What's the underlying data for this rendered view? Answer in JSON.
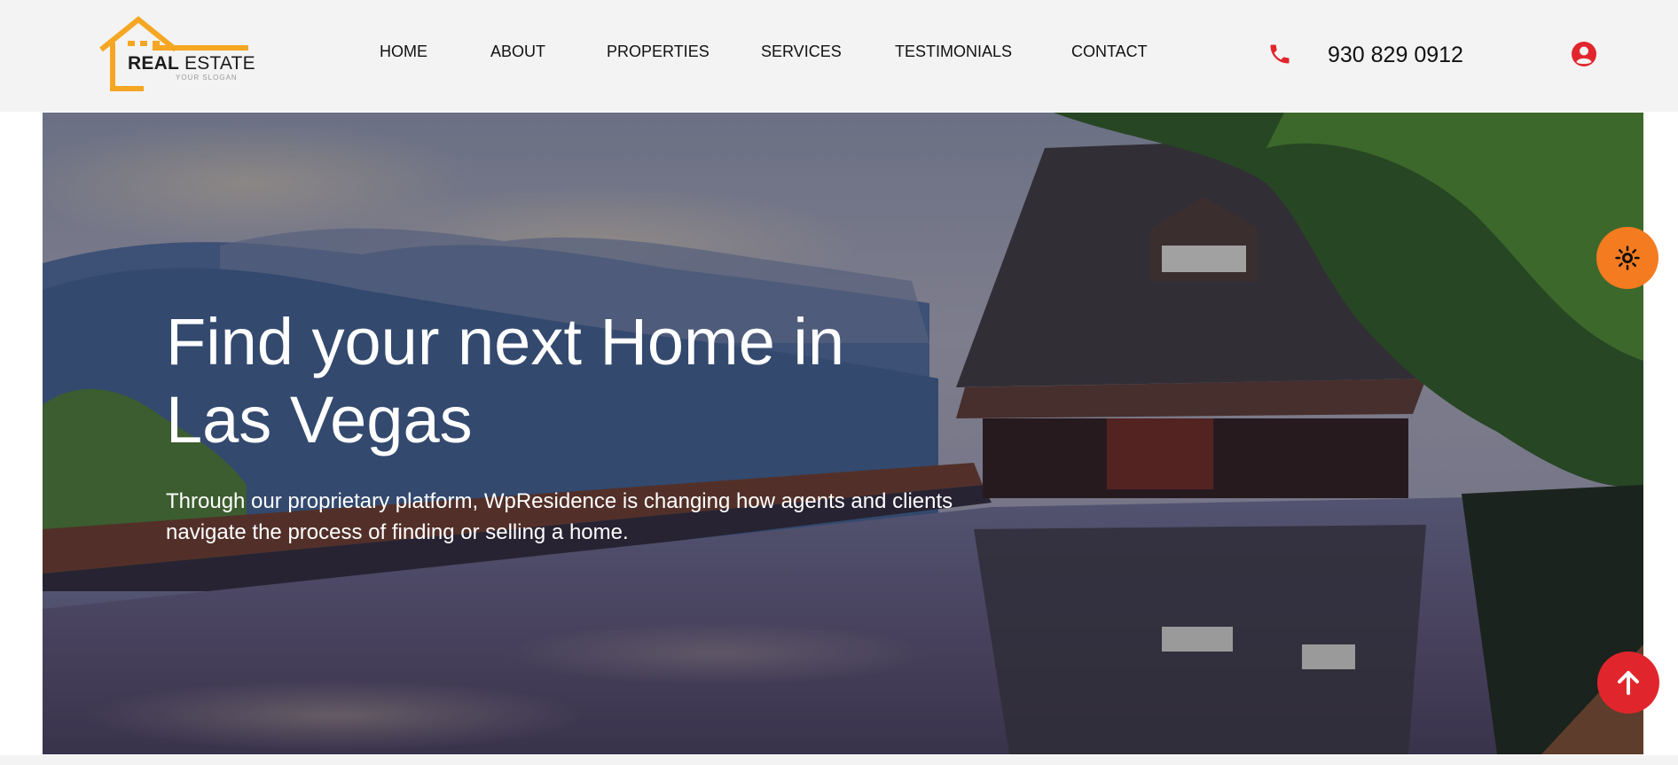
{
  "brand": {
    "name_part1": "REAL",
    "name_part2": "ESTATE",
    "slogan": "YOUR SLOGAN",
    "color": "#f5a623"
  },
  "nav": {
    "items": [
      {
        "label": "HOME"
      },
      {
        "label": "ABOUT"
      },
      {
        "label": "PROPERTIES"
      },
      {
        "label": "SERVICES"
      },
      {
        "label": "TESTIMONIALS"
      },
      {
        "label": "CONTACT"
      }
    ]
  },
  "contact": {
    "phone": "930 829 0912",
    "phone_icon": "phone-icon",
    "accent_color": "#e0262c"
  },
  "account": {
    "icon": "user-icon"
  },
  "hero": {
    "title": "Find your next Home in Las Vegas",
    "subtitle": "Through our proprietary platform, WpResidence is changing how agents and clients navigate the process of finding or selling a home."
  },
  "floating": {
    "theme_icon": "sun-icon",
    "theme_color": "#f47b20",
    "scroll_icon": "arrow-up-icon",
    "scroll_color": "#e0262c"
  }
}
